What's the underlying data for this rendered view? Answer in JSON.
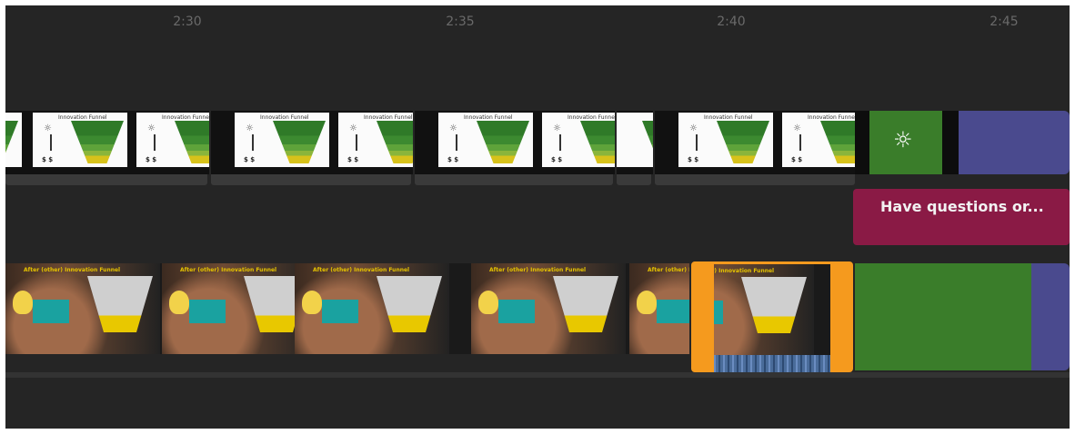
{
  "ruler": {
    "ticks": [
      {
        "label": "2:30"
      },
      {
        "label": "2:35"
      },
      {
        "label": "2:40"
      },
      {
        "label": "2:45"
      }
    ]
  },
  "top_track": {
    "thumb_title": "Innovation Funnel",
    "thumb_money": "$ $",
    "bulb_icon": "lightbulb-icon",
    "colors": {
      "green": "#3a7d2a",
      "purple": "#4a4a8e"
    }
  },
  "mid_track": {
    "title_clip_text": "Have questions or...",
    "color": "#8a1a45"
  },
  "bottom_track": {
    "thumb_title": "After (other) Innovation Funnel",
    "selected_color": "#f59a1e",
    "colors": {
      "green": "#3a7d2a",
      "purple": "#4a4a8e"
    }
  }
}
